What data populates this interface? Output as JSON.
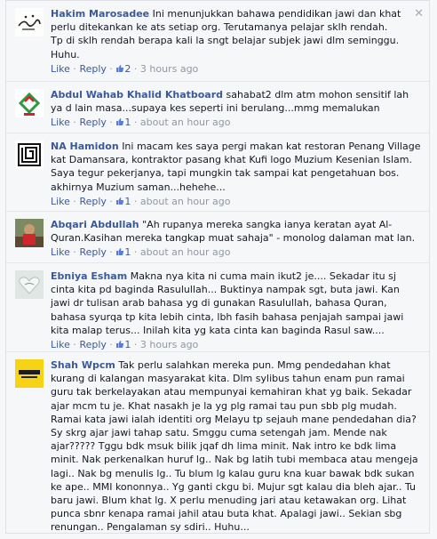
{
  "ui": {
    "close_glyph": "✕",
    "like_label": "Like",
    "reply_label": "Reply",
    "sep": " · "
  },
  "comments": [
    {
      "author": "Hakim Marosadee",
      "text": "Ini menunjukkan bahawa pendidikan jawi dan khat perlu ditekankan ke ats setiap org. Terutamanya pelajar sklh rendah.\nTp di sklh rendah berapa kali la sngt belajar subjek jawi dlm seminggu. Huhu.",
      "likes": "2",
      "time": "3 hours ago",
      "avatar": "calligraphy-avatar"
    },
    {
      "author": "Abdul Wahab Khalid Khatboard",
      "text": "sahabat2 dlm atm mohon sensitif lah ya d lain masa...supaya kes seperti ini berulang...mmg memalukan",
      "likes": "1",
      "time": "about an hour ago",
      "avatar": "green-red-logo-avatar"
    },
    {
      "author": "NA Hamidon",
      "text": "Ini macam kes saya pergi makan kat restoran Penang Village kat Damansara, kontraktor pasang khat Kufi logo Muzium Kesenian Islam. Saya tegur pekerjanya, tapi mungkin tak sampai kat pengetahuan bos. akhirnya Muzium saman...hehehe...",
      "likes": "1",
      "time": "about an hour ago",
      "avatar": "kufi-logo-avatar"
    },
    {
      "author": "Abqari Abdullah",
      "text": "\"Ah rupanya mereka sangka ianya keratan ayat Al-Quran.Kasihan mereka tangkap muat sahaja\" - monolog dalaman mat lan.",
      "likes": "1",
      "time": "about an hour ago",
      "avatar": "photo-avatar"
    },
    {
      "author": "Ebniya Esham",
      "text": "Makna nya kita ni cuma main ikut2 je.... Sekadar itu sj cinta kita pd baginda Rasulullah... Buktinya nampak sgt, buta jawi. Kan jawi dr tulisan arab bahasa yg di gunakan Rasulullah, bahasa Quran, bahasa syurqa tp kita lebih cinta, lbh fasih bahasa penjajah sampai jawi kita malap terus... Inilah kita yg kata cinta kan baginda Rasul saw....",
      "likes": "1",
      "time": "3 hours ago",
      "avatar": "heart-avatar"
    },
    {
      "author": "Shah Wpcm",
      "text": "Tak perlu salahkan mereka pun. Mmg pendedahan khat kurang di kalangan masyarakat kita. Dlm sylibus tahun enam pun ramai guru tak berkelayakan atau mempunyai kemahiran khat yg baik. Sekadar ajar mcm tu je. Khat nasakh je la yg plg ramai tau pun sbb plg mudah. Ramai kata jawi ialah identiti org Melayu tp sejauh mane pendedahan dia? Sy skrg ajar jawi tahap satu. Smggu cuma setengah jam. Mende nak ajar????? Tggu bdk msuk bilik jqaf dh lima minit. Nak intro ke bdk lima minit. Nak perkenalkan huruf lg.. Nak bg latih tubi membaca atau mengeja lagi.. Nak bg menulis lg.. Tu blum lg kalau guru kna kuar bawak bdk sukan ke ape.. MMI kononnya.. Yg ganti ckgu bi. Mujur sgt kalau dia bleh ajar.. Tu baru jawi. Blum khat lg. X perlu menuding jari atau ketawakan org. Lihat punca sbnr kenapa ramai jahil atau buta khat. Apalagi jawi.. Sekian sbg renungan.. Pengalaman sy sdiri.. Huhu...",
      "likes": "",
      "time": "",
      "avatar": "yellow-logo-avatar"
    }
  ]
}
